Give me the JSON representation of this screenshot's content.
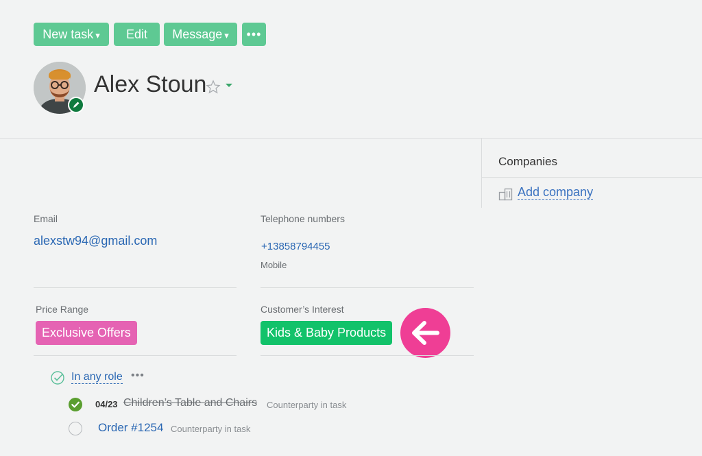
{
  "toolbar": {
    "new_task": "New task",
    "edit": "Edit",
    "message": "Message",
    "more": "•••",
    "caret": "▾"
  },
  "contact": {
    "name": "Alex Stoun"
  },
  "companies": {
    "title": "Companies",
    "add_link": "Add company"
  },
  "fields": {
    "email_label": "Email",
    "email_value": "alexstw94@gmail.com",
    "phone_label": "Telephone numbers",
    "phone_value": "+13858794455",
    "phone_type": "Mobile",
    "price_label": "Price Range",
    "price_value": "Exclusive Offers",
    "interest_label": "Customer’s Interest",
    "interest_value": "Kids & Baby Products"
  },
  "roles": {
    "filter_label": "In any role",
    "more": "•••",
    "items": [
      {
        "date": "04/23",
        "title": "Children’s Table and Chairs",
        "role": "Counterparty in task",
        "status": "done"
      },
      {
        "date": "",
        "title": "Order #1254",
        "role": "Counterparty in task",
        "status": "open"
      }
    ]
  },
  "colors": {
    "button_bg": "#5ec993",
    "price_tag": "#e563b3",
    "interest_tag": "#12c26a",
    "arrow_badge": "#ef3e95",
    "link": "#2a67b3",
    "done_check": "#5a9e2f"
  },
  "icons": [
    "star-icon",
    "caret-down-icon",
    "edit-pencil-icon",
    "building-icon",
    "check-circle-icon",
    "arrow-left-icon"
  ]
}
